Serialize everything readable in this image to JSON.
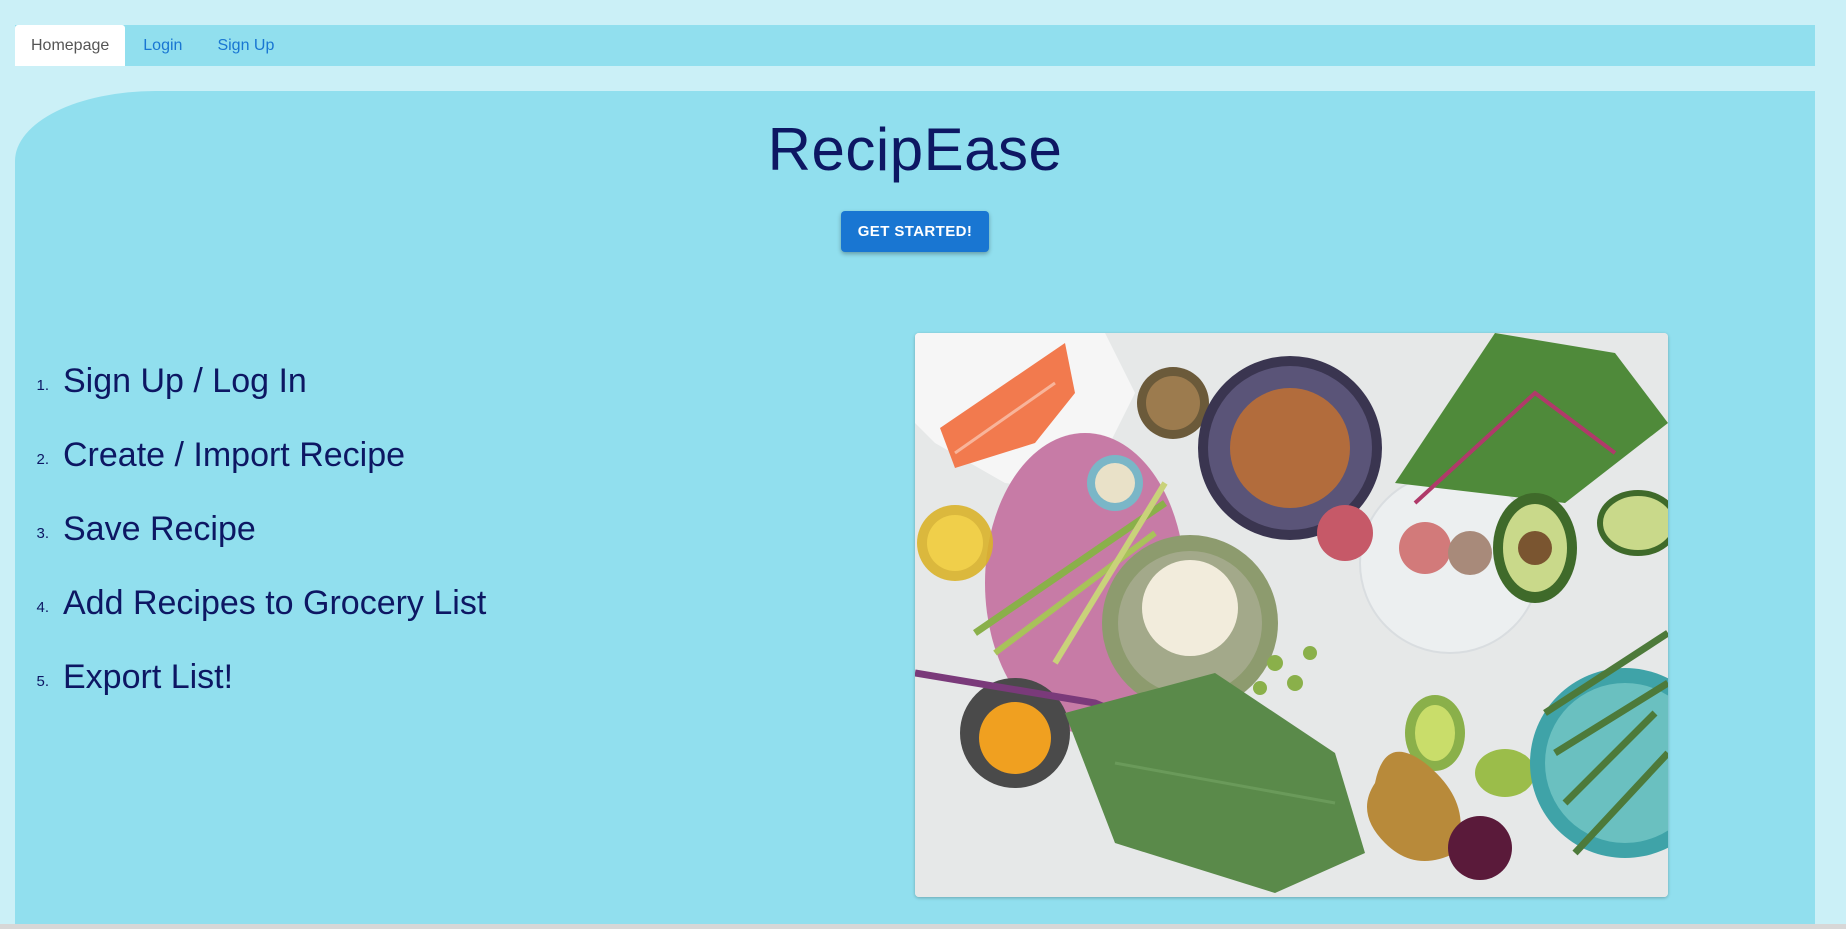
{
  "nav": {
    "tabs": [
      {
        "label": "Homepage"
      },
      {
        "label": "Login"
      },
      {
        "label": "Sign Up"
      }
    ]
  },
  "hero": {
    "title": "RecipEase",
    "cta_label": "GET STARTED!"
  },
  "steps": [
    {
      "num": "1.",
      "text": "Sign Up / Log In"
    },
    {
      "num": "2.",
      "text": "Create / Import Recipe"
    },
    {
      "num": "3.",
      "text": "Save Recipe"
    },
    {
      "num": "4.",
      "text": "Add Recipes to Grocery List"
    },
    {
      "num": "5.",
      "text": "Export List!"
    }
  ],
  "colors": {
    "page_bg": "#cbf0f7",
    "panel_bg": "#91dfee",
    "text_navy": "#0d1763",
    "accent_blue": "#1976d2"
  }
}
